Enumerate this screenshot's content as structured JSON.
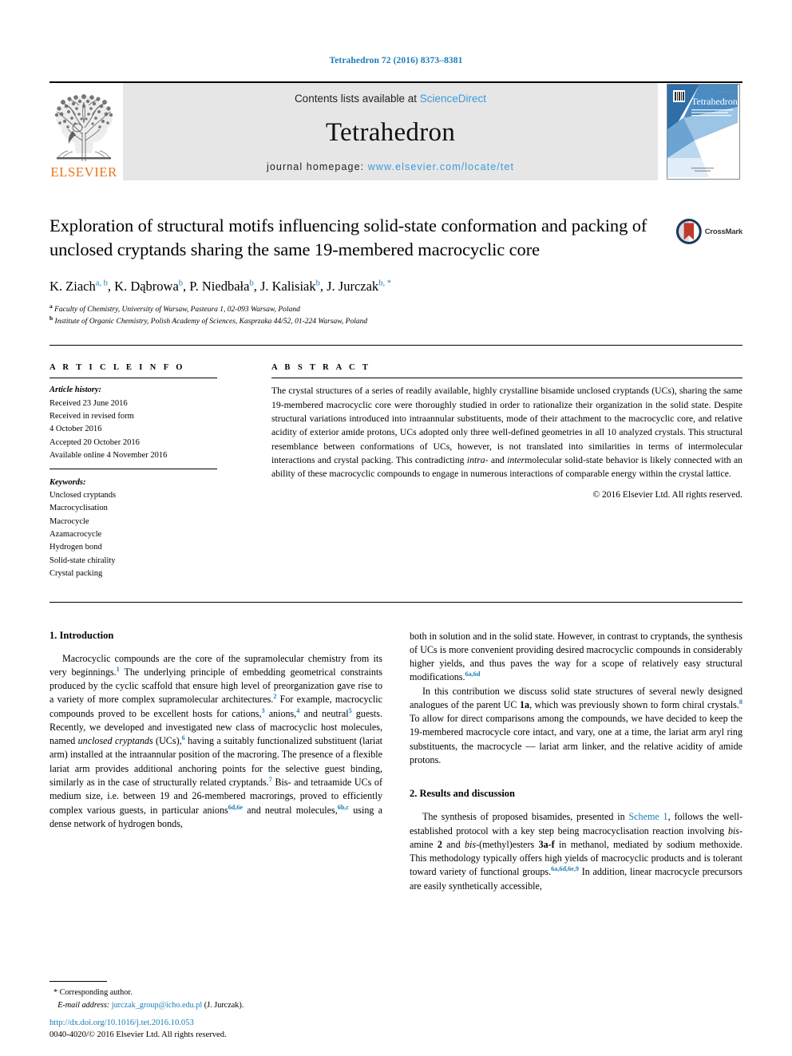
{
  "running_head": "Tetrahedron 72 (2016) 8373–8381",
  "masthead": {
    "publisher_name": "ELSEVIER",
    "contents_prefix": "Contents lists available at ",
    "contents_link": "ScienceDirect",
    "journal_title": "Tetrahedron",
    "homepage_prefix": "journal homepage: ",
    "homepage_url": "www.elsevier.com/locate/tet",
    "cover_title": "Tetrahedron",
    "link_color": "#3a9ad9",
    "elsevier_orange": "#e87722",
    "band_color": "#e6e6e6"
  },
  "title": "Exploration of structural motifs influencing solid-state conformation and packing of unclosed cryptands sharing the same 19-membered macrocyclic core",
  "crossmark": {
    "label": "CrossMark",
    "ring_color": "#1b3a5c",
    "mark_color": "#c0392b"
  },
  "authors": [
    {
      "name": "K. Ziach",
      "marks": "a, b",
      "sep": ", "
    },
    {
      "name": "K. Dąbrowa",
      "marks": "b",
      "sep": ", "
    },
    {
      "name": "P. Niedbała",
      "marks": "b",
      "sep": ", "
    },
    {
      "name": "J. Kalisiak",
      "marks": "b",
      "sep": ", "
    },
    {
      "name": "J. Jurczak",
      "marks": "b, *",
      "sep": ""
    }
  ],
  "affiliations": [
    {
      "mark": "a",
      "text": "Faculty of Chemistry, University of Warsaw, Pasteura 1, 02-093 Warsaw, Poland"
    },
    {
      "mark": "b",
      "text": "Institute of Organic Chemistry, Polish Academy of Sciences, Kasprzaka 44/52, 01-224 Warsaw, Poland"
    }
  ],
  "article_info": {
    "heading": "A R T I C L E   I N F O",
    "history_label": "Article history:",
    "history": [
      "Received 23 June 2016",
      "Received in revised form",
      "4 October 2016",
      "Accepted 20 October 2016",
      "Available online 4 November 2016"
    ],
    "keywords_label": "Keywords:",
    "keywords": [
      "Unclosed cryptands",
      "Macrocyclisation",
      "Macrocycle",
      "Azamacrocycle",
      "Hydrogen bond",
      "Solid-state chirality",
      "Crystal packing"
    ]
  },
  "abstract": {
    "heading": "A B S T R A C T",
    "body_part_1": "The crystal structures of a series of readily available, highly crystalline bisamide unclosed cryptands (UCs), sharing the same 19-membered macrocyclic core were thoroughly studied in order to rationalize their organization in the solid state. Despite structural variations introduced into intraannular substituents, mode of their attachment to the macrocyclic core, and relative acidity of exterior amide protons, UCs adopted only three well-defined geometries in all 10 analyzed crystals. This structural resemblance between conformations of UCs, however, is not translated into similarities in terms of intermolecular interactions and crystal packing. This contradicting ",
    "italic_1": "intra-",
    "body_part_2": " and ",
    "italic_2": "inter",
    "body_part_3": "molecular solid-state behavior is likely connected with an ability of these macrocyclic compounds to engage in numerous interactions of comparable energy within the crystal lattice.",
    "copyright": "© 2016 Elsevier Ltd. All rights reserved."
  },
  "body": {
    "left_column": {
      "heading_1": "1. Introduction",
      "para_1_a": "Macrocyclic compounds are the core of the supramolecular chemistry from its very beginnings.",
      "ref_1": "1",
      "para_1_b": " The underlying principle of embedding geometrical constraints produced by the cyclic scaffold that ensure high level of preorganization gave rise to a variety of more complex supramolecular architectures.",
      "ref_2": "2",
      "para_1_c": " For example, macrocyclic compounds proved to be excellent hosts for cations,",
      "ref_3": "3",
      "para_1_d": " anions,",
      "ref_4": "4",
      "para_1_e": " and neutral",
      "ref_5": "5",
      "para_1_f": " guests. Recently, we developed and investigated new class of macrocyclic host molecules, named ",
      "italic_uc": "unclosed cryptands",
      "para_1_g": " (UCs),",
      "ref_6": "6",
      "para_1_h": " having a suitably functionalized substituent (lariat arm) installed at the intraannular position of the macroring. The presence of a flexible lariat arm provides additional anchoring points for the selective guest binding, similarly as in the case of structurally related cryptands.",
      "ref_7": "7",
      "para_1_i": " Bis- and tetraamide UCs of medium size, i.e. between 19 and 26-membered macrorings, proved to efficiently complex various guests, in particular anions",
      "ref_6d6e": "6d,6e",
      "para_1_j": " and neutral molecules,",
      "ref_6bc": "6b,c",
      "para_1_k": " using a dense network of hydrogen bonds,"
    },
    "right_column": {
      "para_2_a": "both in solution and in the solid state. However, in contrast to cryptands, the synthesis of UCs is more convenient providing desired macrocyclic compounds in considerably higher yields, and thus paves the way for a scope of relatively easy structural modifications.",
      "ref_6a6d": "6a,6d",
      "para_3_a": "In this contribution we discuss solid state structures of several newly designed analogues of the parent UC ",
      "bold_1a": "1a",
      "para_3_b": ", which was previously shown to form chiral crystals.",
      "ref_8": "8",
      "para_3_c": " To allow for direct comparisons among the compounds, we have decided to keep the 19-membered macrocycle core intact, and vary, one at a time, the lariat arm aryl ring substituents, the macrocycle — lariat arm linker, and the relative acidity of amide protons.",
      "heading_2": "2. Results and discussion",
      "para_4_a": "The synthesis of proposed bisamides, presented in ",
      "link_scheme": "Scheme 1",
      "para_4_b": ", follows the well-established protocol with a key step being macrocyclisation reaction involving ",
      "italic_bis1": "bis",
      "para_4_c": "-amine ",
      "bold_2": "2",
      "para_4_d": " and ",
      "italic_bis2": "bis",
      "para_4_e": "-(methyl)esters ",
      "bold_3af": "3a-f",
      "para_4_f": " in methanol, mediated by sodium methoxide. This methodology typically offers high yields of macrocyclic products and is tolerant toward variety of functional groups.",
      "ref_6a6d6e9": "6a,6d,6e,9",
      "para_4_g": " In addition, linear macrocycle precursors are easily synthetically accessible,"
    }
  },
  "footnote": {
    "star": "*",
    "corresponding": "Corresponding author.",
    "email_label": "E-mail address:",
    "email": "jurczak_group@icho.edu.pl",
    "email_owner": "(J. Jurczak)."
  },
  "footer": {
    "doi": "http://dx.doi.org/10.1016/j.tet.2016.10.053",
    "issn_line": "0040-4020/© 2016 Elsevier Ltd. All rights reserved."
  }
}
